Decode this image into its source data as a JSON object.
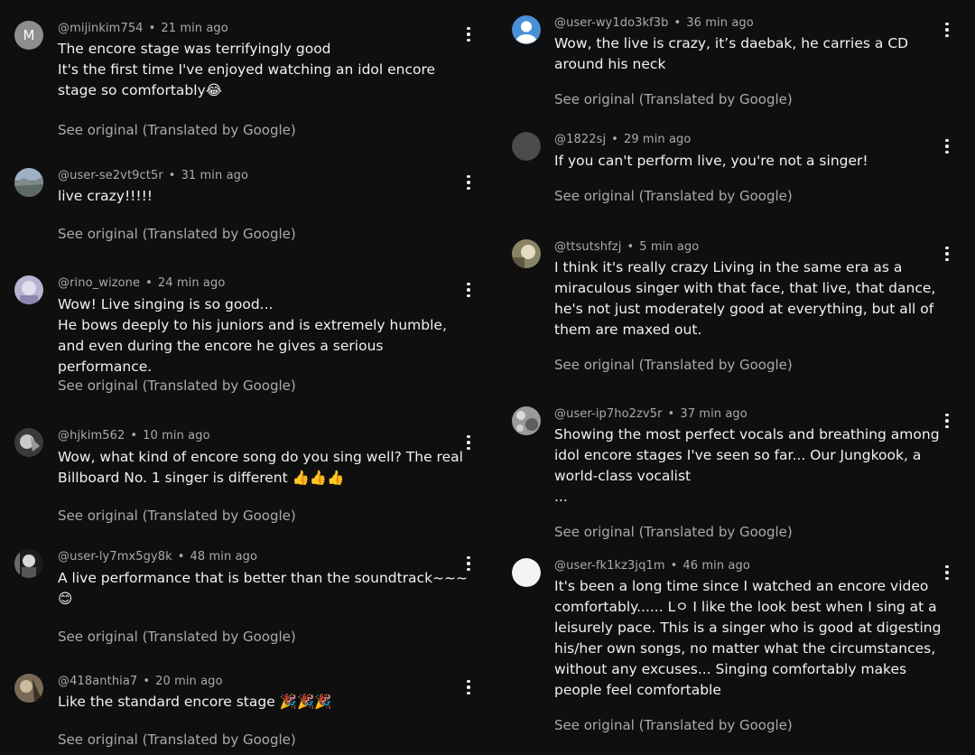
{
  "comments": [
    {
      "handle": "@mijinkim754",
      "time": "21 min ago",
      "text": "The encore stage was terrifyingly good\nIt's the first time I've enjoyed watching an idol encore stage so comfortably😂",
      "see_original": "See original (Translated by Google)",
      "avatar": "letter-m",
      "avatar_letter": "M"
    },
    {
      "handle": "@user-se2vt9ct5r",
      "time": "31 min ago",
      "text": "live crazy!!!!!",
      "see_original": "See original (Translated by Google)",
      "avatar": "landscape-photo"
    },
    {
      "handle": "@rino_wizone",
      "time": "24 min ago",
      "text": "Wow! Live singing is so good...\nHe bows deeply to his juniors and is extremely humble, and even during the encore he gives a serious performance.",
      "see_original": "See original (Translated by Google)",
      "avatar": "photo-lavender"
    },
    {
      "handle": "@hjkim562",
      "time": "10 min ago",
      "text": "Wow, what kind of encore song do you sing well? The real Billboard No. 1 singer is different 👍👍👍",
      "see_original": "See original (Translated by Google)",
      "avatar": "photo-grey"
    },
    {
      "handle": "@user-ly7mx5gy8k",
      "time": "48 min ago",
      "text": "A live performance that is better than the soundtrack~~~\n😊",
      "see_original": "See original (Translated by Google)",
      "avatar": "photo-dark"
    },
    {
      "handle": "@418anthia7",
      "time": "20 min ago",
      "text": "Like the standard encore stage 🎉🎉🎉",
      "see_original": "See original (Translated by Google)",
      "avatar": "photo-sepia"
    },
    {
      "handle": "@user-wy1do3kf3b",
      "time": "36 min ago",
      "text": "Wow, the live is crazy, it’s daebak, he carries a CD around his neck",
      "see_original": "See original (Translated by Google)",
      "avatar": "default-user-blue"
    },
    {
      "handle": "@1822sj",
      "time": "29 min ago",
      "text": "If you can't perform live, you're not a singer!",
      "see_original": "See original (Translated by Google)",
      "avatar": "blank-grey"
    },
    {
      "handle": "@ttsutshfzj",
      "time": "5 min ago",
      "text": "I think it's really crazy Living in the same era as a miraculous singer with that face, that live, that dance, he's not just moderately good at everything, but all of them are maxed out.",
      "see_original": "See original (Translated by Google)",
      "avatar": "photo-olive"
    },
    {
      "handle": "@user-ip7ho2zv5r",
      "time": "37 min ago",
      "text": "Showing the most perfect vocals and breathing among idol encore stages I've seen so far... Our Jungkook, a world-class vocalist\n...",
      "see_original": "See original (Translated by Google)",
      "avatar": "photo-pattern"
    },
    {
      "handle": "@user-fk1kz3jq1m",
      "time": "46 min ago",
      "text": "It's been a long time since I watched an encore video comfortably...... Lㅇ I like the look best when I sing at a leisurely pace. This is a singer who is good at digesting his/her own songs, no matter what the circumstances, without any excuses... Singing comfortably makes people feel comfortable",
      "see_original": "See original (Translated by Google)",
      "avatar": "blank-white"
    }
  ],
  "colors": {
    "background": "#0f0f0f",
    "text": "#f1f1f1",
    "muted": "#aaaaaa",
    "default_avatar": "#4a90d9"
  }
}
